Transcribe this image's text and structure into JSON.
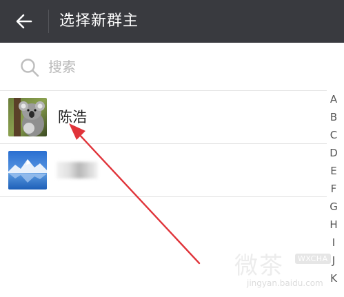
{
  "header": {
    "title": "选择新群主"
  },
  "search": {
    "placeholder": "搜索",
    "value": ""
  },
  "contacts": [
    {
      "name": "陈浩",
      "avatar": "koala-avatar"
    },
    {
      "name": "",
      "avatar": "landscape-avatar"
    }
  ],
  "index_letters": [
    "A",
    "B",
    "C",
    "D",
    "E",
    "F",
    "G",
    "H",
    "I",
    "J",
    "K"
  ],
  "annotation": {
    "color": "#e0343a"
  },
  "watermark": {
    "text": "微茶",
    "tag": "WXCHA",
    "sub": "jingyan.baidu.com"
  },
  "colors": {
    "topbar": "#393a3f",
    "divider": "#e3e3e3"
  }
}
